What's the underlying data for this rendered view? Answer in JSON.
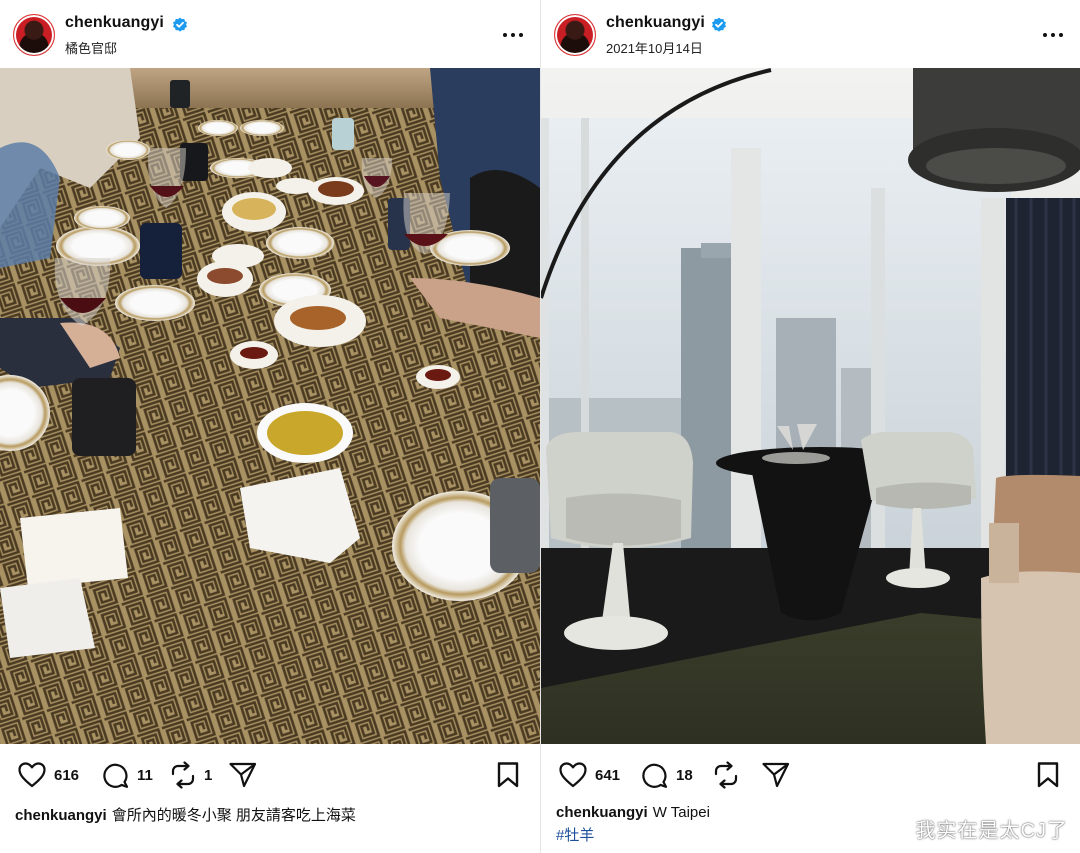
{
  "posts": [
    {
      "username": "chenkuangyi",
      "subtitle": "橘色官邸",
      "photo_description": "",
      "likes": "616",
      "comments": "11",
      "reposts": "1",
      "caption_user": "chenkuangyi",
      "caption_text": "會所內的暖冬小聚 朋友請客吃上海菜",
      "hashtag": ""
    },
    {
      "username": "chenkuangyi",
      "subtitle": "2021年10月14日",
      "photo_description": "",
      "likes": "641",
      "comments": "18",
      "reposts": "",
      "caption_user": "chenkuangyi",
      "caption_text": "W Taipei",
      "hashtag": "#牡羊"
    }
  ],
  "watermark": "我实在是太CJ了",
  "icons": {
    "verified": "verified-badge-icon",
    "more": "more-options-icon",
    "like": "heart-icon",
    "comment": "comment-bubble-icon",
    "repost": "repost-icon",
    "share": "send-icon",
    "bookmark": "bookmark-icon"
  },
  "colors": {
    "verified_blue": "#1d9bf0",
    "hashtag": "#1e4f9c",
    "avatar_red": "#c81e24"
  }
}
